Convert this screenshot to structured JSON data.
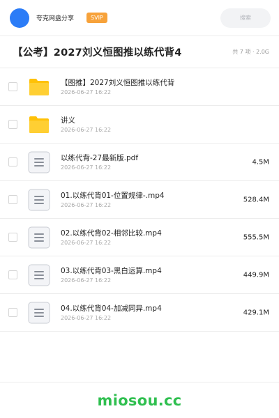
{
  "topbar": {
    "username": "夸克网盘分享",
    "badge": "SVIP",
    "search_placeholder": "搜索"
  },
  "header": {
    "title": "【公考】2027刘义恒图推以练代背4",
    "meta": "共 7 项 · 2.0G"
  },
  "files": [
    {
      "name": "【图推】2027刘义恒图推以练代背",
      "date": "2026-06-27 16:22",
      "size": "",
      "type": "folder"
    },
    {
      "name": "讲义",
      "date": "2026-06-27 16:22",
      "size": "",
      "type": "folder"
    },
    {
      "name": "以练代背-27最新版.pdf",
      "date": "2026-06-27 16:22",
      "size": "4.5M",
      "type": "document"
    },
    {
      "name": "01.以练代背01-位置规律-.mp4",
      "date": "2026-06-27 16:22",
      "size": "528.4M",
      "type": "document"
    },
    {
      "name": "02.以练代背02-相邻比较.mp4",
      "date": "2026-06-27 16:22",
      "size": "555.5M",
      "type": "document"
    },
    {
      "name": "03.以练代背03-黑白运算.mp4",
      "date": "2026-06-27 16:22",
      "size": "449.9M",
      "type": "document"
    },
    {
      "name": "04.以练代背04-加减同异.mp4",
      "date": "2026-06-27 16:22",
      "size": "429.1M",
      "type": "document"
    }
  ],
  "footer": {
    "brand": "miosou.cc"
  },
  "colors": {
    "avatar": "#2b7cf7",
    "badge": "#f7a23a",
    "folder": "#ffc107",
    "brand": "#2fbf4f"
  }
}
